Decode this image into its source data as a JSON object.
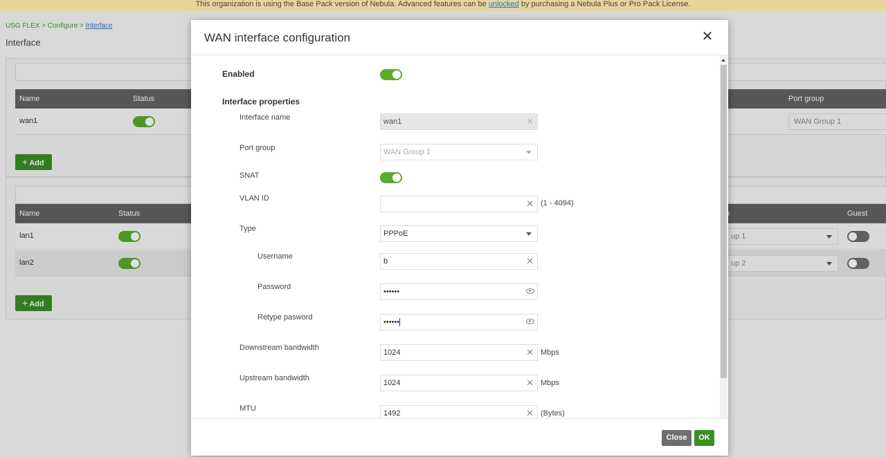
{
  "banner": {
    "text_before": "This organization is using the Base Pack version of Nebula. Advanced features can be ",
    "link": "unlocked",
    "text_after": " by purchasing a Nebula Plus or Pro Pack License."
  },
  "breadcrumb": {
    "device": "USG FLEX",
    "sep": ">",
    "section": "Configure",
    "current": "Interface"
  },
  "page_title": "Interface",
  "wan_table": {
    "headers": {
      "name": "Name",
      "status": "Status",
      "port_group": "Port group"
    },
    "rows": [
      {
        "name": "wan1",
        "status": "on",
        "port_group": "WAN Group 1"
      }
    ],
    "add_label": "Add"
  },
  "lan_table": {
    "headers": {
      "name": "Name",
      "status": "Status",
      "port_group_partial": "p",
      "guest": "Guest"
    },
    "rows": [
      {
        "name": "lan1",
        "status": "on",
        "port_group_partial": "up 1",
        "guest": "off"
      },
      {
        "name": "lan2",
        "status": "on",
        "port_group_partial": "up 2",
        "guest": "off"
      }
    ],
    "add_label": "Add"
  },
  "modal": {
    "title": "WAN interface configuration",
    "close_icon": "close-icon",
    "enabled_label": "Enabled",
    "enabled": true,
    "properties_label": "Interface properties",
    "fields": {
      "interface_name": {
        "label": "Interface name",
        "value": "wan1"
      },
      "port_group": {
        "label": "Port group",
        "value": "WAN Group 1"
      },
      "snat": {
        "label": "SNAT",
        "value": true
      },
      "vlan_id": {
        "label": "VLAN ID",
        "value": "",
        "hint": "(1 - 4094)"
      },
      "type": {
        "label": "Type",
        "value": "PPPoE"
      },
      "username": {
        "label": "Username",
        "value": "b"
      },
      "password": {
        "label": "Password",
        "value": "••••••"
      },
      "retype_password": {
        "label": "Retype pasword",
        "value": "••••••"
      },
      "downstream": {
        "label": "Downstream bandwidth",
        "value": "1024",
        "unit": "Mbps"
      },
      "upstream": {
        "label": "Upstream bandwidth",
        "value": "1024",
        "unit": "Mbps"
      },
      "mtu": {
        "label": "MTU",
        "value": "1492",
        "unit": "(Bytes)"
      }
    },
    "footer": {
      "close_label": "Close",
      "ok_label": "OK"
    }
  },
  "colors": {
    "accent": "#5bac2a",
    "button_green": "#3a8f27",
    "banner_bg": "#e6d69a",
    "table_header": "#636363"
  }
}
